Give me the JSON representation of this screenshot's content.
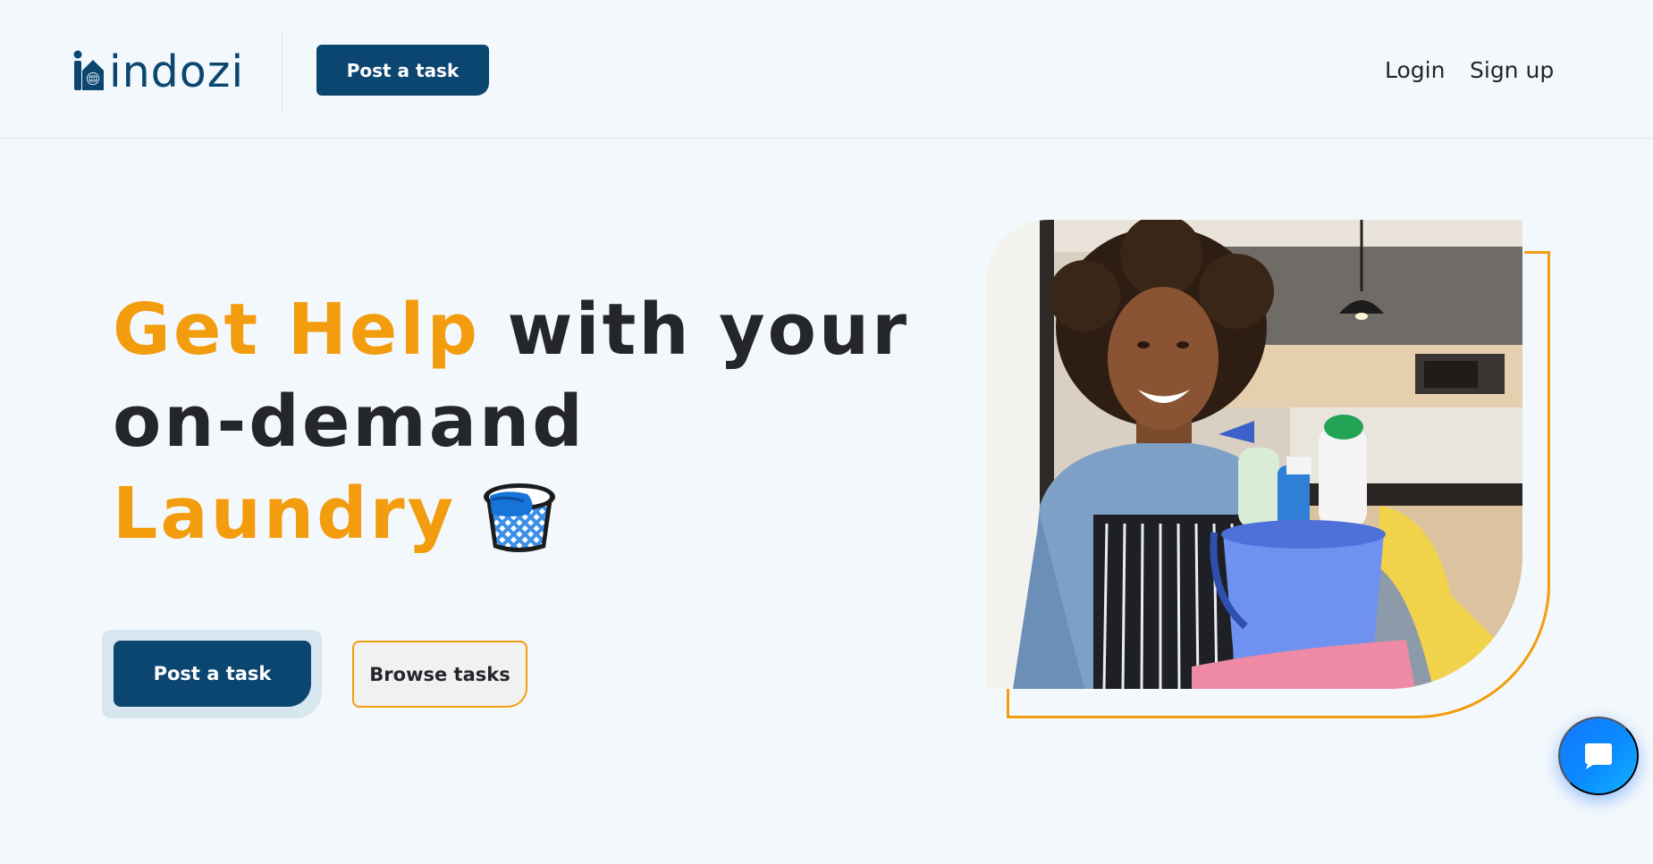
{
  "header": {
    "logo_text": "indozi",
    "post_task_label": "Post a task",
    "nav": {
      "login": "Login",
      "signup": "Sign up"
    }
  },
  "hero": {
    "title_accent_1": "Get Help",
    "title_part_1": " with your",
    "title_part_2": "on-demand",
    "title_accent_2": "Laundry",
    "title_icon": "laundry-basket-icon",
    "post_task_label": "Post a task",
    "browse_tasks_label": "Browse tasks",
    "image_subject": "woman holding bucket of cleaning supplies in kitchen"
  },
  "chat": {
    "icon": "chat-bubble-icon"
  },
  "colors": {
    "primary": "#0b4670",
    "accent": "#f39c0d",
    "background": "#f3f8fc",
    "text": "#22252b",
    "chat": "#1677ff"
  }
}
